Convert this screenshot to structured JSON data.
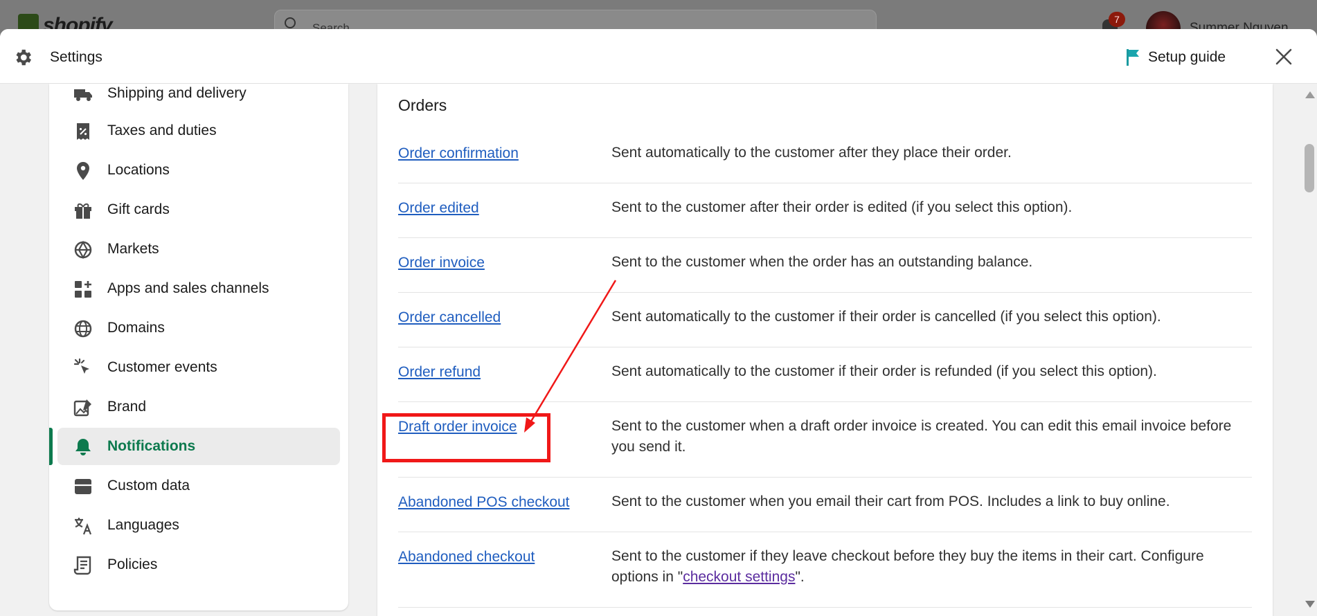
{
  "background": {
    "logo_text": "shopify",
    "search_placeholder": "Search",
    "notification_count": "7",
    "user_name": "Summer Nguyen"
  },
  "header": {
    "title": "Settings",
    "setup_guide_label": "Setup guide"
  },
  "sidebar": {
    "items": [
      {
        "label": "Shipping and delivery",
        "icon": "truck-icon"
      },
      {
        "label": "Taxes and duties",
        "icon": "receipt-percent-icon"
      },
      {
        "label": "Locations",
        "icon": "location-pin-icon"
      },
      {
        "label": "Gift cards",
        "icon": "gift-icon"
      },
      {
        "label": "Markets",
        "icon": "globe-icon"
      },
      {
        "label": "Apps and sales channels",
        "icon": "apps-icon"
      },
      {
        "label": "Domains",
        "icon": "domain-globe-icon"
      },
      {
        "label": "Customer events",
        "icon": "cursor-click-icon"
      },
      {
        "label": "Brand",
        "icon": "brand-image-icon"
      },
      {
        "label": "Notifications",
        "icon": "bell-icon",
        "active": true
      },
      {
        "label": "Custom data",
        "icon": "custom-data-icon"
      },
      {
        "label": "Languages",
        "icon": "translate-icon"
      },
      {
        "label": "Policies",
        "icon": "policy-scroll-icon"
      }
    ]
  },
  "main": {
    "section_title": "Orders",
    "rows": [
      {
        "link": "Order confirmation",
        "description": "Sent automatically to the customer after they place their order."
      },
      {
        "link": "Order edited",
        "description": "Sent to the customer after their order is edited (if you select this option)."
      },
      {
        "link": "Order invoice",
        "description": "Sent to the customer when the order has an outstanding balance."
      },
      {
        "link": "Order cancelled",
        "description": "Sent automatically to the customer if their order is cancelled (if you select this option)."
      },
      {
        "link": "Order refund",
        "description": "Sent automatically to the customer if their order is refunded (if you select this option)."
      },
      {
        "link": "Draft order invoice",
        "description": "Sent to the customer when a draft order invoice is created. You can edit this email invoice before you send it."
      },
      {
        "link": "Abandoned POS checkout",
        "description": "Sent to the customer when you email their cart from POS. Includes a link to buy online."
      },
      {
        "link": "Abandoned checkout",
        "description_before": "Sent to the customer if they leave checkout before they buy the items in their cart. Configure options in \"",
        "description_link": "checkout settings",
        "description_after": "\"."
      }
    ]
  },
  "colors": {
    "accent_green": "#0d7a4e",
    "link_blue": "#1f5dbf",
    "visited_purple": "#5b2c9f",
    "annotation_red": "#f01818"
  }
}
